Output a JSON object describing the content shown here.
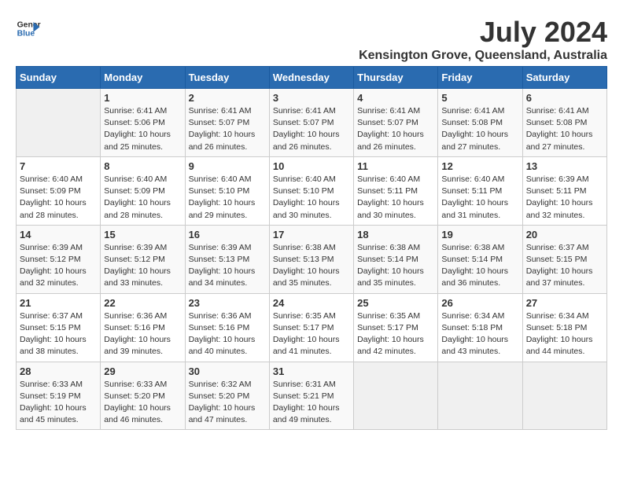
{
  "logo": {
    "line1": "General",
    "line2": "Blue"
  },
  "title": "July 2024",
  "subtitle": "Kensington Grove, Queensland, Australia",
  "weekdays": [
    "Sunday",
    "Monday",
    "Tuesday",
    "Wednesday",
    "Thursday",
    "Friday",
    "Saturday"
  ],
  "weeks": [
    [
      {
        "day": "",
        "info": ""
      },
      {
        "day": "1",
        "info": "Sunrise: 6:41 AM\nSunset: 5:06 PM\nDaylight: 10 hours\nand 25 minutes."
      },
      {
        "day": "2",
        "info": "Sunrise: 6:41 AM\nSunset: 5:07 PM\nDaylight: 10 hours\nand 26 minutes."
      },
      {
        "day": "3",
        "info": "Sunrise: 6:41 AM\nSunset: 5:07 PM\nDaylight: 10 hours\nand 26 minutes."
      },
      {
        "day": "4",
        "info": "Sunrise: 6:41 AM\nSunset: 5:07 PM\nDaylight: 10 hours\nand 26 minutes."
      },
      {
        "day": "5",
        "info": "Sunrise: 6:41 AM\nSunset: 5:08 PM\nDaylight: 10 hours\nand 27 minutes."
      },
      {
        "day": "6",
        "info": "Sunrise: 6:41 AM\nSunset: 5:08 PM\nDaylight: 10 hours\nand 27 minutes."
      }
    ],
    [
      {
        "day": "7",
        "info": "Sunrise: 6:40 AM\nSunset: 5:09 PM\nDaylight: 10 hours\nand 28 minutes."
      },
      {
        "day": "8",
        "info": "Sunrise: 6:40 AM\nSunset: 5:09 PM\nDaylight: 10 hours\nand 28 minutes."
      },
      {
        "day": "9",
        "info": "Sunrise: 6:40 AM\nSunset: 5:10 PM\nDaylight: 10 hours\nand 29 minutes."
      },
      {
        "day": "10",
        "info": "Sunrise: 6:40 AM\nSunset: 5:10 PM\nDaylight: 10 hours\nand 30 minutes."
      },
      {
        "day": "11",
        "info": "Sunrise: 6:40 AM\nSunset: 5:11 PM\nDaylight: 10 hours\nand 30 minutes."
      },
      {
        "day": "12",
        "info": "Sunrise: 6:40 AM\nSunset: 5:11 PM\nDaylight: 10 hours\nand 31 minutes."
      },
      {
        "day": "13",
        "info": "Sunrise: 6:39 AM\nSunset: 5:11 PM\nDaylight: 10 hours\nand 32 minutes."
      }
    ],
    [
      {
        "day": "14",
        "info": "Sunrise: 6:39 AM\nSunset: 5:12 PM\nDaylight: 10 hours\nand 32 minutes."
      },
      {
        "day": "15",
        "info": "Sunrise: 6:39 AM\nSunset: 5:12 PM\nDaylight: 10 hours\nand 33 minutes."
      },
      {
        "day": "16",
        "info": "Sunrise: 6:39 AM\nSunset: 5:13 PM\nDaylight: 10 hours\nand 34 minutes."
      },
      {
        "day": "17",
        "info": "Sunrise: 6:38 AM\nSunset: 5:13 PM\nDaylight: 10 hours\nand 35 minutes."
      },
      {
        "day": "18",
        "info": "Sunrise: 6:38 AM\nSunset: 5:14 PM\nDaylight: 10 hours\nand 35 minutes."
      },
      {
        "day": "19",
        "info": "Sunrise: 6:38 AM\nSunset: 5:14 PM\nDaylight: 10 hours\nand 36 minutes."
      },
      {
        "day": "20",
        "info": "Sunrise: 6:37 AM\nSunset: 5:15 PM\nDaylight: 10 hours\nand 37 minutes."
      }
    ],
    [
      {
        "day": "21",
        "info": "Sunrise: 6:37 AM\nSunset: 5:15 PM\nDaylight: 10 hours\nand 38 minutes."
      },
      {
        "day": "22",
        "info": "Sunrise: 6:36 AM\nSunset: 5:16 PM\nDaylight: 10 hours\nand 39 minutes."
      },
      {
        "day": "23",
        "info": "Sunrise: 6:36 AM\nSunset: 5:16 PM\nDaylight: 10 hours\nand 40 minutes."
      },
      {
        "day": "24",
        "info": "Sunrise: 6:35 AM\nSunset: 5:17 PM\nDaylight: 10 hours\nand 41 minutes."
      },
      {
        "day": "25",
        "info": "Sunrise: 6:35 AM\nSunset: 5:17 PM\nDaylight: 10 hours\nand 42 minutes."
      },
      {
        "day": "26",
        "info": "Sunrise: 6:34 AM\nSunset: 5:18 PM\nDaylight: 10 hours\nand 43 minutes."
      },
      {
        "day": "27",
        "info": "Sunrise: 6:34 AM\nSunset: 5:18 PM\nDaylight: 10 hours\nand 44 minutes."
      }
    ],
    [
      {
        "day": "28",
        "info": "Sunrise: 6:33 AM\nSunset: 5:19 PM\nDaylight: 10 hours\nand 45 minutes."
      },
      {
        "day": "29",
        "info": "Sunrise: 6:33 AM\nSunset: 5:20 PM\nDaylight: 10 hours\nand 46 minutes."
      },
      {
        "day": "30",
        "info": "Sunrise: 6:32 AM\nSunset: 5:20 PM\nDaylight: 10 hours\nand 47 minutes."
      },
      {
        "day": "31",
        "info": "Sunrise: 6:31 AM\nSunset: 5:21 PM\nDaylight: 10 hours\nand 49 minutes."
      },
      {
        "day": "",
        "info": ""
      },
      {
        "day": "",
        "info": ""
      },
      {
        "day": "",
        "info": ""
      }
    ]
  ]
}
